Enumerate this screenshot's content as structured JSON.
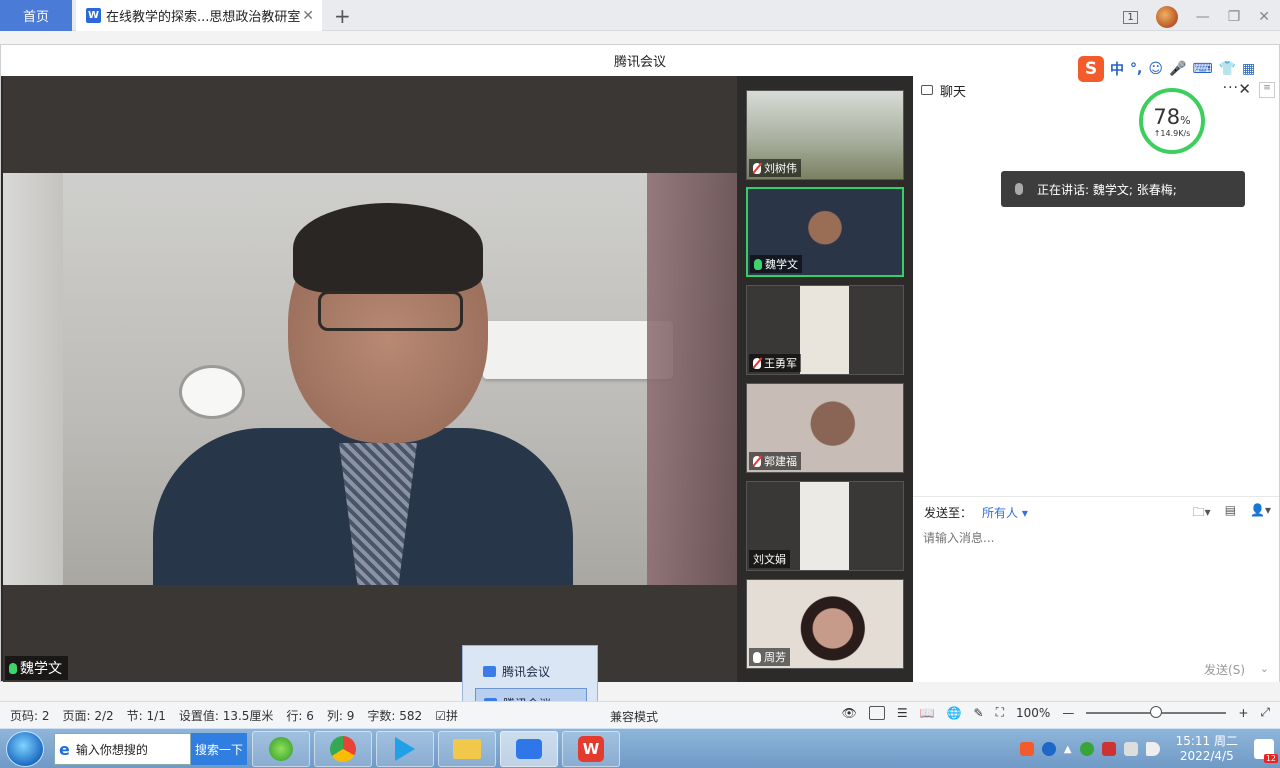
{
  "wps": {
    "home_tab": "首页",
    "doc_tab": "在线教学的探索...思想政治教研室",
    "doc_close": "✕",
    "add_tab": "+",
    "win_badge": "1"
  },
  "meeting": {
    "title": "腾讯会议",
    "main_speaker": "魏学文",
    "participants": [
      {
        "name": "刘树伟",
        "mic": "muted"
      },
      {
        "name": "魏学文",
        "mic": "on",
        "active": true
      },
      {
        "name": "王勇军",
        "mic": "muted"
      },
      {
        "name": "郭建福",
        "mic": "muted"
      },
      {
        "name": "刘文娟",
        "mic": "none"
      },
      {
        "name": "周芳",
        "mic": "idle"
      }
    ]
  },
  "chat": {
    "title": "聊天",
    "more": "···",
    "speaking_banner": "正在讲话: 魏学文; 张春梅;",
    "send_to_label": "发送至：",
    "send_to_target": "所有人 ▾",
    "input_placeholder": "请输入消息...",
    "send_button": "发送(S)"
  },
  "network_gauge": {
    "percent": "78",
    "percent_unit": "%",
    "rate": "↑14.9K/s"
  },
  "ime": {
    "logo": "S",
    "mode": "中",
    "punct": "°,"
  },
  "taskbar_popup": {
    "items": [
      "腾讯会议",
      "腾讯会议"
    ]
  },
  "statusbar": {
    "page_code": "页码: 2",
    "page": "页面: 2/2",
    "section": "节: 1/1",
    "setting": "设置值: 13.5厘米",
    "row": "行: 6",
    "col": "列: 9",
    "words": "字数: 582",
    "spell": "拼",
    "compat": "兼容模式",
    "zoom": "100%"
  },
  "taskbar": {
    "search_placeholder": "输入你想搜的",
    "search_button": "搜索一下",
    "time": "15:11 周二",
    "date": "2022/4/5",
    "notif_count": "12"
  }
}
